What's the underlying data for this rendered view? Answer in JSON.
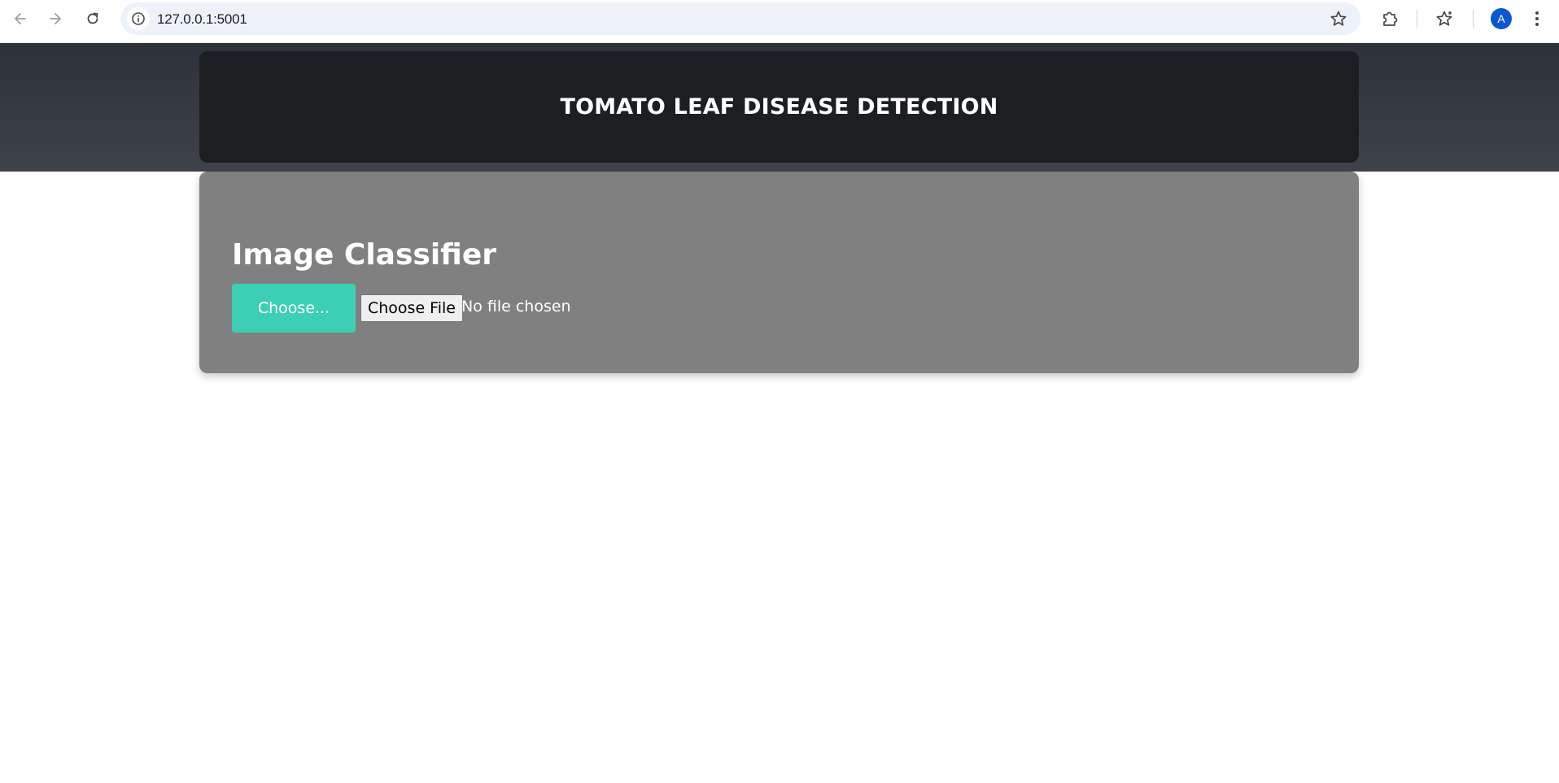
{
  "browser": {
    "url": "127.0.0.1:5001",
    "avatar_initial": "A",
    "icons": {
      "back": "arrow-left-icon",
      "forward": "arrow-right-icon",
      "reload": "reload-icon",
      "site_info": "info-icon",
      "bookmark": "star-icon",
      "extensions": "puzzle-icon",
      "bookmarks_list": "bookmark-star-icon",
      "menu": "kebab-menu-icon"
    }
  },
  "page": {
    "title": "TOMATO LEAF DISEASE DETECTION",
    "classifier": {
      "heading": "Image Classifier",
      "choose_button_label": "Choose...",
      "file_button_label": "Choose File",
      "file_status": "No file chosen"
    }
  },
  "colors": {
    "header_band": "#343941",
    "title_card": "#1c1f22",
    "classifier_card": "#808080",
    "accent_button": "#3ccfb6",
    "avatar": "#0b57d0"
  }
}
